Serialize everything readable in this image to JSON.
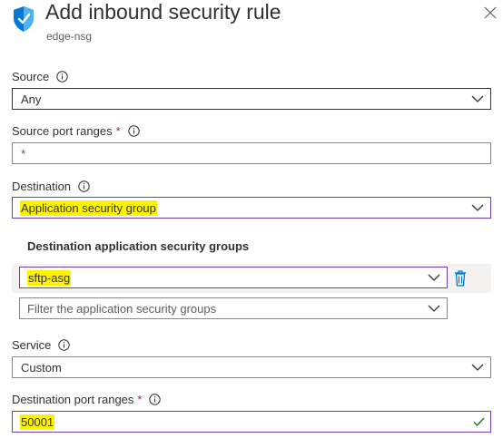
{
  "header": {
    "title": "Add inbound security rule",
    "subtitle": "edge-nsg"
  },
  "source": {
    "label": "Source",
    "value": "Any"
  },
  "source_port_ranges": {
    "label": "Source port ranges",
    "required_mark": "*",
    "value": "*"
  },
  "destination": {
    "label": "Destination",
    "value": "Application security group"
  },
  "destination_asg": {
    "heading": "Destination application security groups",
    "selected": "sftp-asg",
    "filter_placeholder": "Filter the application security groups"
  },
  "service": {
    "label": "Service",
    "value": "Custom"
  },
  "destination_port_ranges": {
    "label": "Destination port ranges",
    "required_mark": "*",
    "value": "50001"
  },
  "colors": {
    "highlight": "#fff200",
    "focus_border": "#6c3fb0",
    "icon_blue": "#0078d4",
    "valid_green": "#107c10"
  }
}
